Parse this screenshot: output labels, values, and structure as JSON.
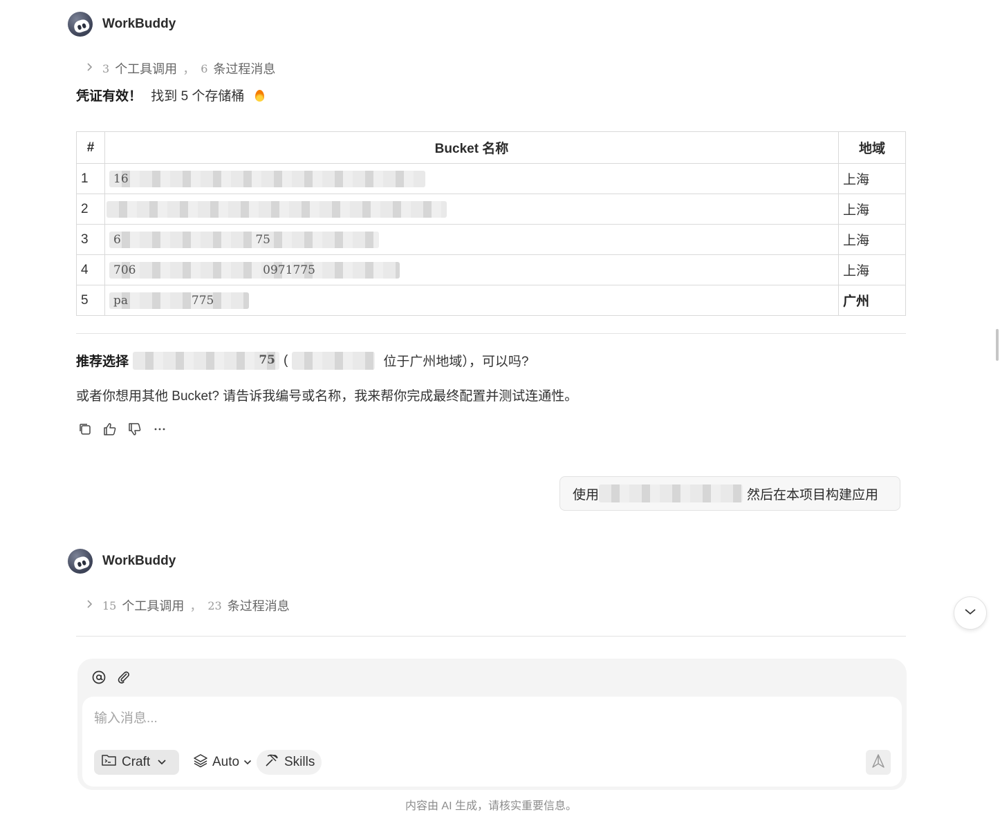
{
  "agent": {
    "name": "WorkBuddy"
  },
  "message1": {
    "process": {
      "tool_count": "3",
      "tool_text": "个工具调用",
      "sep": "，",
      "msg_count": "6",
      "msg_text": "条过程消息"
    },
    "lead_bold": "凭证有效！",
    "lead_text": "找到 5 个存储桶"
  },
  "table": {
    "headers": [
      "#",
      "Bucket 名称",
      "地域"
    ],
    "rows": [
      {
        "idx": "1",
        "name": "16",
        "region": "上海"
      },
      {
        "idx": "2",
        "name": "",
        "region": "上海"
      },
      {
        "idx": "3",
        "name": "6                                    75",
        "region": "上海"
      },
      {
        "idx": "4",
        "name": "706                                  0971775",
        "region": "上海"
      },
      {
        "idx": "5",
        "name": "pa                 775",
        "region": "广州"
      }
    ]
  },
  "recommend": {
    "bold": "推荐选择",
    "masked_tail": "75",
    "paren_open": "(",
    "rest": "位于广州地域），可以吗?"
  },
  "other_line": "或者你想用其他 Bucket? 请告诉我编号或名称，我来帮你完成最终配置并测试连通性。",
  "user_message": {
    "prefix": "使用",
    "suffix": "然后在本项目构建应用"
  },
  "message2": {
    "process": {
      "tool_count": "15",
      "tool_text": "个工具调用",
      "sep": "，",
      "msg_count": "23",
      "msg_text": "条过程消息"
    }
  },
  "composer": {
    "placeholder": "输入消息...",
    "mode_label": "Craft",
    "model_label": "Auto",
    "skills_label": "Skills"
  },
  "footer_note": "内容由 AI 生成，请核实重要信息。",
  "icons": [
    "chevron-right-icon",
    "flame-icon",
    "copy-icon",
    "thumbs-up-icon",
    "thumbs-down-icon",
    "more-icon",
    "chevron-down-icon",
    "at-icon",
    "paperclip-icon",
    "folder-terminal-icon",
    "layers-icon",
    "pickaxe-icon",
    "send-icon"
  ],
  "colors": {
    "flame": "#f57c00",
    "border": "#d9d9d9",
    "composer_bg": "#f4f4f4"
  }
}
